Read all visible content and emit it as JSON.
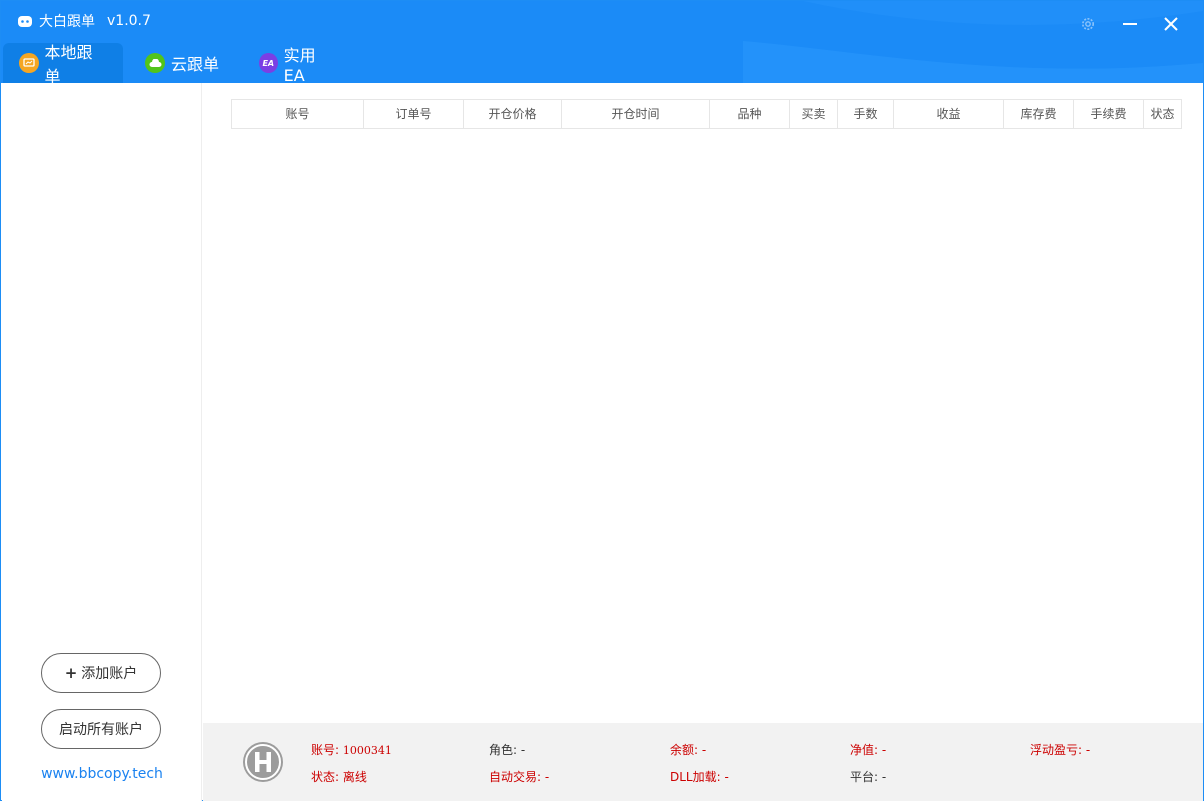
{
  "app": {
    "title": "大白跟单",
    "version": "v1.0.7"
  },
  "tabs": [
    {
      "label": "本地跟单",
      "icon": "local-copy-icon",
      "color": "#f5a623"
    },
    {
      "label": "云跟单",
      "icon": "cloud-icon",
      "color": "#52c41a"
    },
    {
      "label": "实用EA",
      "icon": "ea-icon",
      "color": "#7b3fe4",
      "icon_text": "EA"
    }
  ],
  "sidebar": {
    "add_account_label": "添加账户",
    "start_all_label": "启动所有账户",
    "website": "www.bbcopy.tech"
  },
  "table": {
    "columns": [
      "账号",
      "订单号",
      "开仓价格",
      "开仓时间",
      "品种",
      "买卖",
      "手数",
      "收益",
      "库存费",
      "手续费",
      "状态"
    ],
    "rows": []
  },
  "status": {
    "account_label": "账号:",
    "account_value": "1000341",
    "state_label": "状态:",
    "state_value": "离线",
    "role_label": "角色:",
    "role_value": "-",
    "auto_trade_label": "自动交易:",
    "auto_trade_value": "-",
    "balance_label": "余额:",
    "balance_value": "-",
    "dll_label": "DLL加载:",
    "dll_value": "-",
    "equity_label": "净值:",
    "equity_value": "-",
    "platform_label": "平台:",
    "platform_value": "-",
    "floating_label": "浮动盈亏:",
    "floating_value": "-"
  },
  "colors": {
    "titlebar": "#1b8bf7",
    "accent_red": "#cc0000",
    "link": "#1a82f0"
  }
}
